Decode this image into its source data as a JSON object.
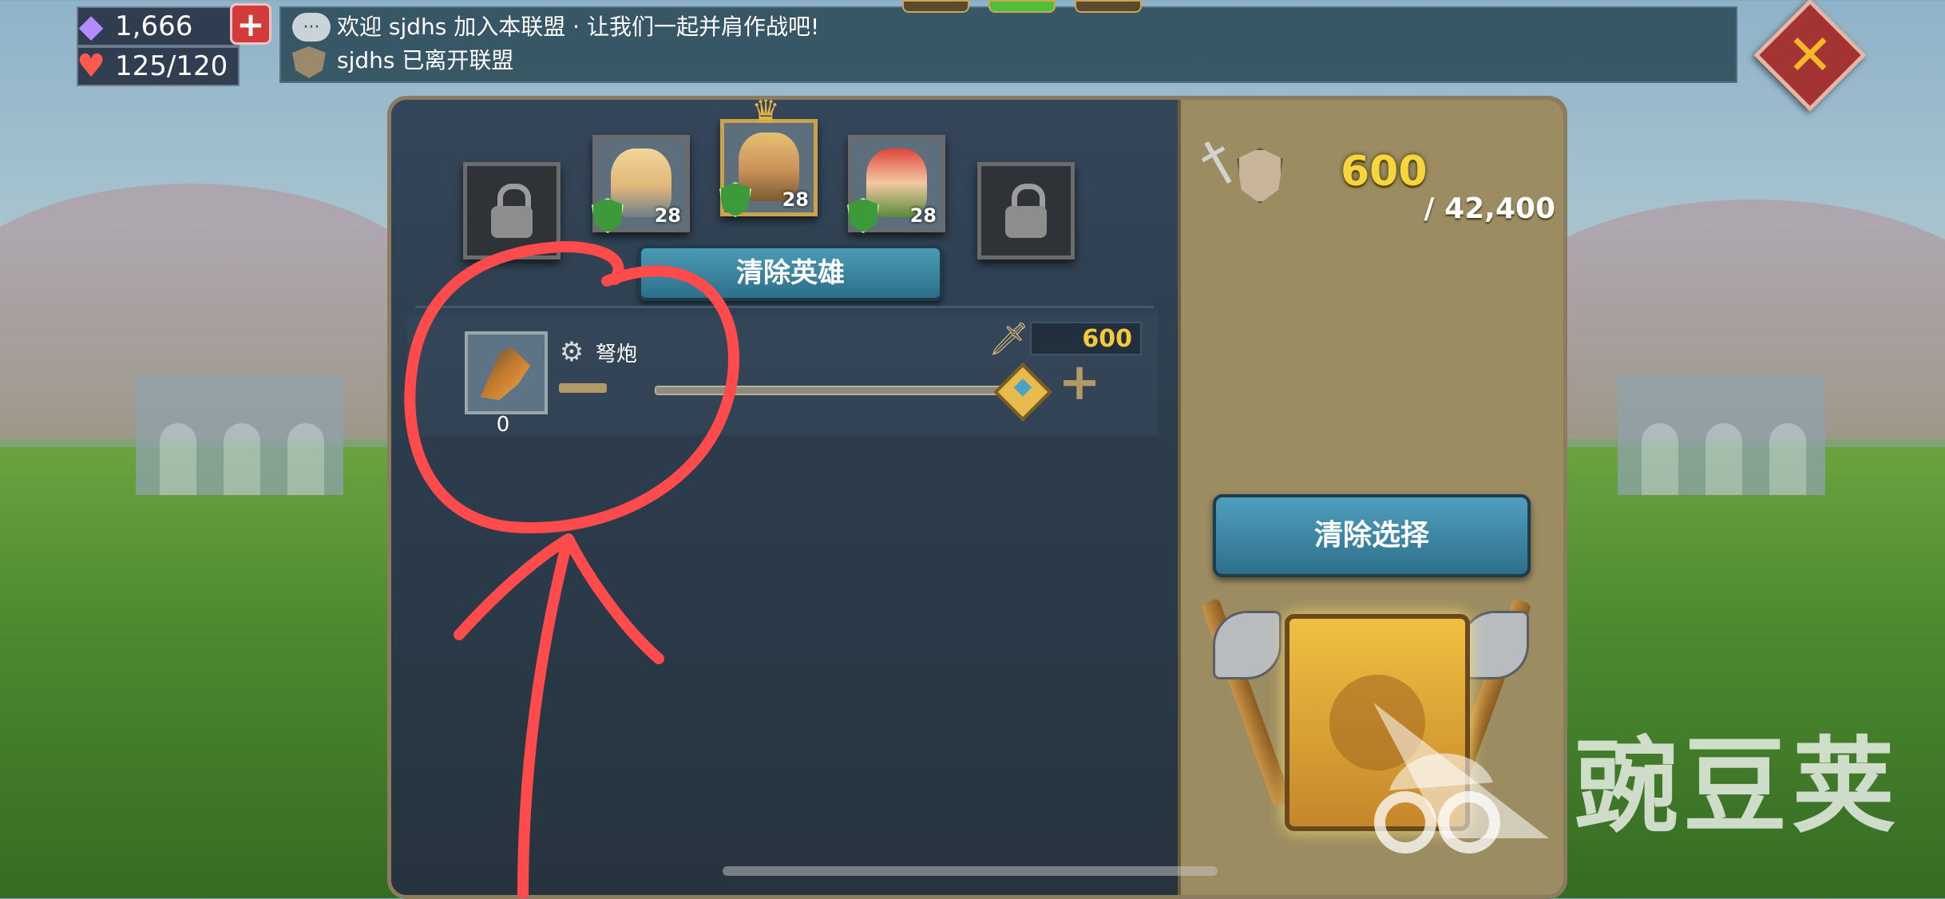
{
  "resources": {
    "gems": "1,666",
    "stamina": "125/120"
  },
  "chat": {
    "line1": "欢迎 sjdhs 加入本联盟 · 让我们一起并肩作战吧!",
    "line2": "sjdhs 已离开联盟"
  },
  "heroes": {
    "slots": [
      {
        "state": "locked"
      },
      {
        "state": "hero",
        "level": "28"
      },
      {
        "state": "hero",
        "level": "28"
      },
      {
        "state": "hero",
        "level": "28"
      },
      {
        "state": "locked"
      }
    ],
    "clear_label": "清除英雄"
  },
  "troop": {
    "name": "弩炮",
    "count": "0",
    "power": "600"
  },
  "summary": {
    "power": "600",
    "max_power": "/ 42,400",
    "clear_selection_label": "清除选择"
  },
  "watermark": {
    "text": "豌豆荚"
  },
  "colors": {
    "annotation": "#ff4b4b",
    "gold_text": "#f6d63c",
    "button_blue": "#2e6f8c"
  },
  "icons": [
    "gem-icon",
    "heart-icon",
    "plus-icon",
    "chat-bubble-icon",
    "alliance-shield-icon",
    "close-icon",
    "lock-icon",
    "crown-icon",
    "ballista-icon",
    "siege-type-icon",
    "sword-icon",
    "minus-icon",
    "power-shield-icon",
    "march-icon"
  ]
}
